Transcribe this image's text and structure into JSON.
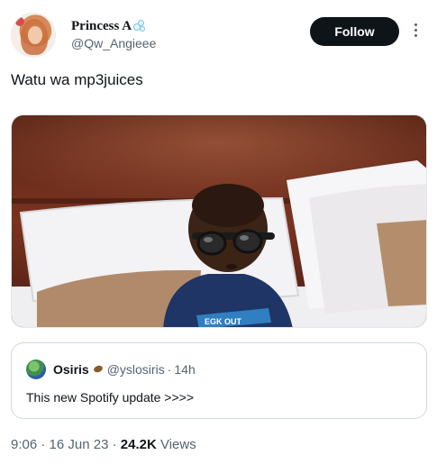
{
  "author": {
    "display_name": "Princess A",
    "name_badge": "bubbles-emoji",
    "handle": "@Qw_Angieee"
  },
  "actions": {
    "follow_label": "Follow",
    "more_icon": "more-vertical-icon"
  },
  "tweet": {
    "text": "Watu wa mp3juices",
    "media_description_icon": "photo"
  },
  "quoted": {
    "name": "Osiris",
    "name_badge": "planet-emoji",
    "handle": "@yslosiris",
    "separator": "·",
    "time": "14h",
    "text": "This new Spotify update >>>>"
  },
  "meta": {
    "time": "9:06",
    "sep1": "·",
    "date": "16 Jun 23",
    "sep2": "·",
    "views_count": "24.2K",
    "views_label": "Views"
  },
  "colors": {
    "text_primary": "#0f1419",
    "text_secondary": "#536471",
    "follow_bg": "#0f1419",
    "border": "#cfd9de"
  }
}
